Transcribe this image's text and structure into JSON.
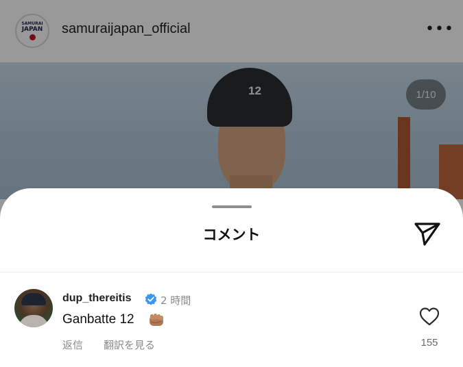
{
  "post": {
    "account": "samuraijapan_official",
    "avatar_lettering": {
      "top": "SAMURAI",
      "main": "JAPAN"
    },
    "helmet_number": "12",
    "media_counter": "1/10",
    "more_icon": "more-horizontal-icon"
  },
  "sheet": {
    "title": "コメント",
    "send_icon": "paper-plane-icon"
  },
  "comments": [
    {
      "username": "dup_thereitis",
      "verified": true,
      "time": "2 時間",
      "text": "Ganbatte 12",
      "emoji_icon": "fist-emoji-icon",
      "reply_label": "返信",
      "translate_label": "翻訳を見る",
      "like_icon": "heart-outline-icon",
      "like_count": "155"
    }
  ],
  "colors": {
    "verified_badge": "#3897f0",
    "secondary_text": "#8a8a8a",
    "overlay": "rgba(0,0,0,0.4)"
  }
}
